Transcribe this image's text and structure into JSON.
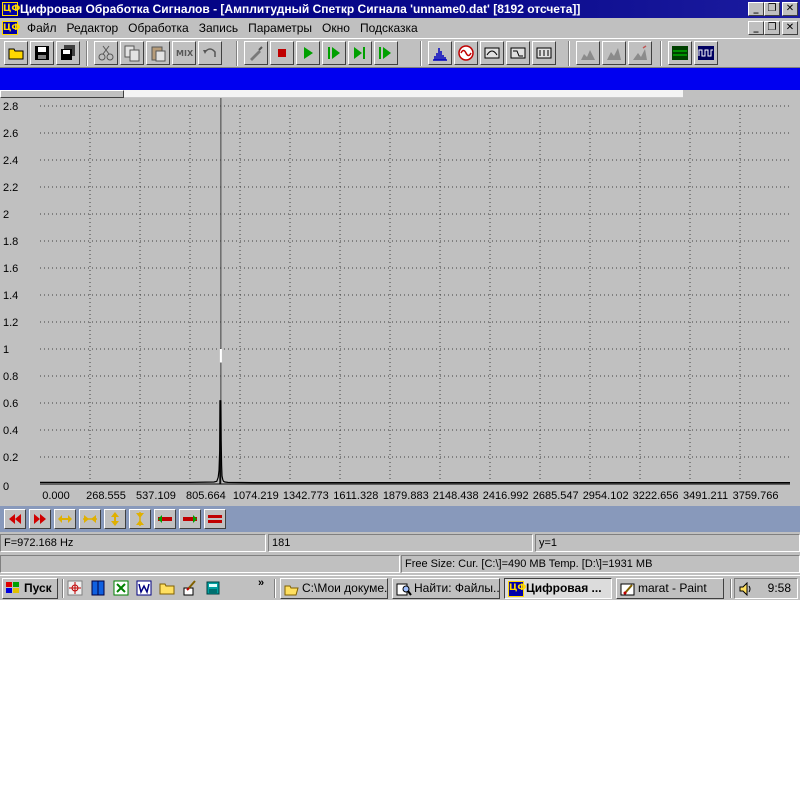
{
  "window": {
    "title": "Цифровая Обработка Сигналов - [Амплитудный Спеткр Сигнала 'unname0.dat' [8192 отсчета]]",
    "app_icon_text": "ЦФ",
    "minimize_glyph": "_",
    "restore_glyph": "❐",
    "close_glyph": "✕"
  },
  "menu": [
    "Файл",
    "Редактор",
    "Обработка",
    "Запись",
    "Параметры",
    "Окно",
    "Подсказка"
  ],
  "toolbar": {
    "groups": [
      [
        "open-icon",
        "save-icon",
        "save-all-icon"
      ],
      [
        "cut-icon",
        "copy-icon",
        "paste-icon",
        "mix-icon",
        "undo-icon"
      ],
      [
        "probe-icon",
        "stop-icon",
        "play-icon",
        "play-step-icon",
        "play-end-icon",
        "play-loop-icon"
      ],
      [
        "spectrum-icon",
        "sine-icon",
        "filter-a-icon",
        "filter-b-icon",
        "filter-c-icon"
      ],
      [
        "hist-a-icon",
        "hist-b-icon",
        "hist-c-icon"
      ],
      [
        "window-split-icon",
        "waveform-icon"
      ]
    ],
    "mix_label": "MIX"
  },
  "scroll": {
    "position": 0.18
  },
  "chart_data": {
    "type": "line",
    "title": "",
    "xlabel": "",
    "ylabel": "",
    "x_ticks": [
      "0.000",
      "268.555",
      "537.109",
      "805.664",
      "1074.219",
      "1342.773",
      "1611.328",
      "1879.883",
      "2148.438",
      "2416.992",
      "2685.547",
      "2954.102",
      "3222.656",
      "3491.211",
      "3759.766"
    ],
    "y_ticks": [
      "0",
      "0.2",
      "0.4",
      "0.6",
      "0.8",
      "1",
      "1.2",
      "1.4",
      "1.6",
      "1.8",
      "2",
      "2.2",
      "2.4",
      "2.6",
      "2.8"
    ],
    "xlim": [
      0,
      4031
    ],
    "ylim": [
      0,
      2.8
    ],
    "grid": true,
    "cursor_x": 972.168,
    "series": [
      {
        "x": [
          0,
          800,
          935,
          950,
          958,
          962,
          966,
          968,
          970,
          972.168,
          974,
          976,
          978,
          982,
          986,
          994,
          1010,
          1150,
          4031
        ],
        "y": [
          0.012,
          0.012,
          0.015,
          0.02,
          0.05,
          0.1,
          0.25,
          0.62,
          0.58,
          0.62,
          0.32,
          0.14,
          0.06,
          0.035,
          0.02,
          0.015,
          0.012,
          0.01,
          0.01
        ]
      }
    ],
    "colors": {
      "line": "#000000",
      "grid": "#404040",
      "cursor": "#ffffff",
      "background": "#c0c0c0"
    }
  },
  "nav_buttons": [
    "rewind-icon",
    "fast-forward-icon",
    "zoom-out-h-icon",
    "zoom-in-h-icon",
    "zoom-out-v-icon",
    "zoom-in-v-icon",
    "red-left-icon",
    "red-right-icon",
    "red-fit-icon"
  ],
  "status": {
    "freq": "F=972.168 Hz",
    "index": "181",
    "yval": "y=1",
    "free_size": "Free Size: Cur. [C:\\]=490 MB Temp. [D:\\]=1931 MB"
  },
  "taskbar": {
    "start": "Пуск",
    "quick_launch": [
      "crosshair-app-icon",
      "book-icon",
      "excel-icon",
      "word-icon",
      "folder-icon",
      "paint-brush-icon",
      "calculator-icon"
    ],
    "chevron": "»",
    "tasks": [
      {
        "label": "C:\\Мои докуме...",
        "icon": "folder-icon",
        "active": false
      },
      {
        "label": "Найти: Файлы...",
        "icon": "find-icon",
        "active": false
      },
      {
        "label": "Цифровая ...",
        "icon": "dsp-app-icon",
        "active": true
      },
      {
        "label": "marat - Paint",
        "icon": "paint-icon",
        "active": false
      }
    ],
    "clock": "9:58"
  }
}
